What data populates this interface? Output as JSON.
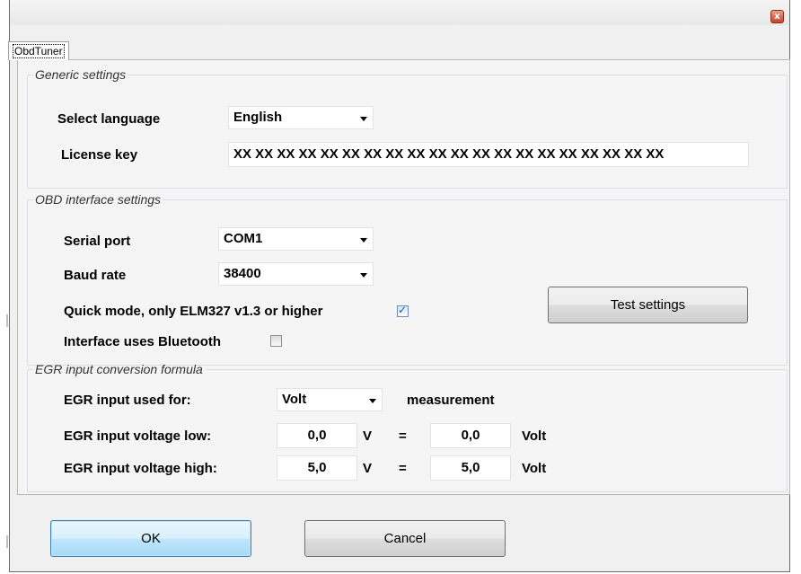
{
  "window": {
    "close_glyph": "x"
  },
  "tab": {
    "label": "ObdTuner"
  },
  "generic": {
    "title": "Generic settings",
    "language_label": "Select language",
    "language_value": "English",
    "license_label": "License key",
    "license_value": "XX XX XX XX XX XX XX XX XX XX XX XX XX XX XX XX XX XX XX XX"
  },
  "obd": {
    "title": "OBD interface settings",
    "serial_label": "Serial port",
    "serial_value": "COM1",
    "baud_label": "Baud rate",
    "baud_value": "38400",
    "quick_label": "Quick mode, only ELM327 v1.3 or higher",
    "quick_checked": true,
    "bt_label": "Interface uses Bluetooth",
    "bt_checked": false,
    "test_button": "Test settings"
  },
  "egr": {
    "title": "EGR input conversion formula",
    "used_label": "EGR input used for:",
    "used_value": "Volt",
    "measurement": "measurement",
    "low_label": "EGR input voltage low:",
    "low_input": "0,0",
    "low_output": "0,0",
    "high_label": "EGR input voltage high:",
    "high_input": "5,0",
    "high_output": "5,0",
    "unit_v": "V",
    "equals": "=",
    "unit_volt": "Volt"
  },
  "footer": {
    "ok": "OK",
    "cancel": "Cancel"
  }
}
